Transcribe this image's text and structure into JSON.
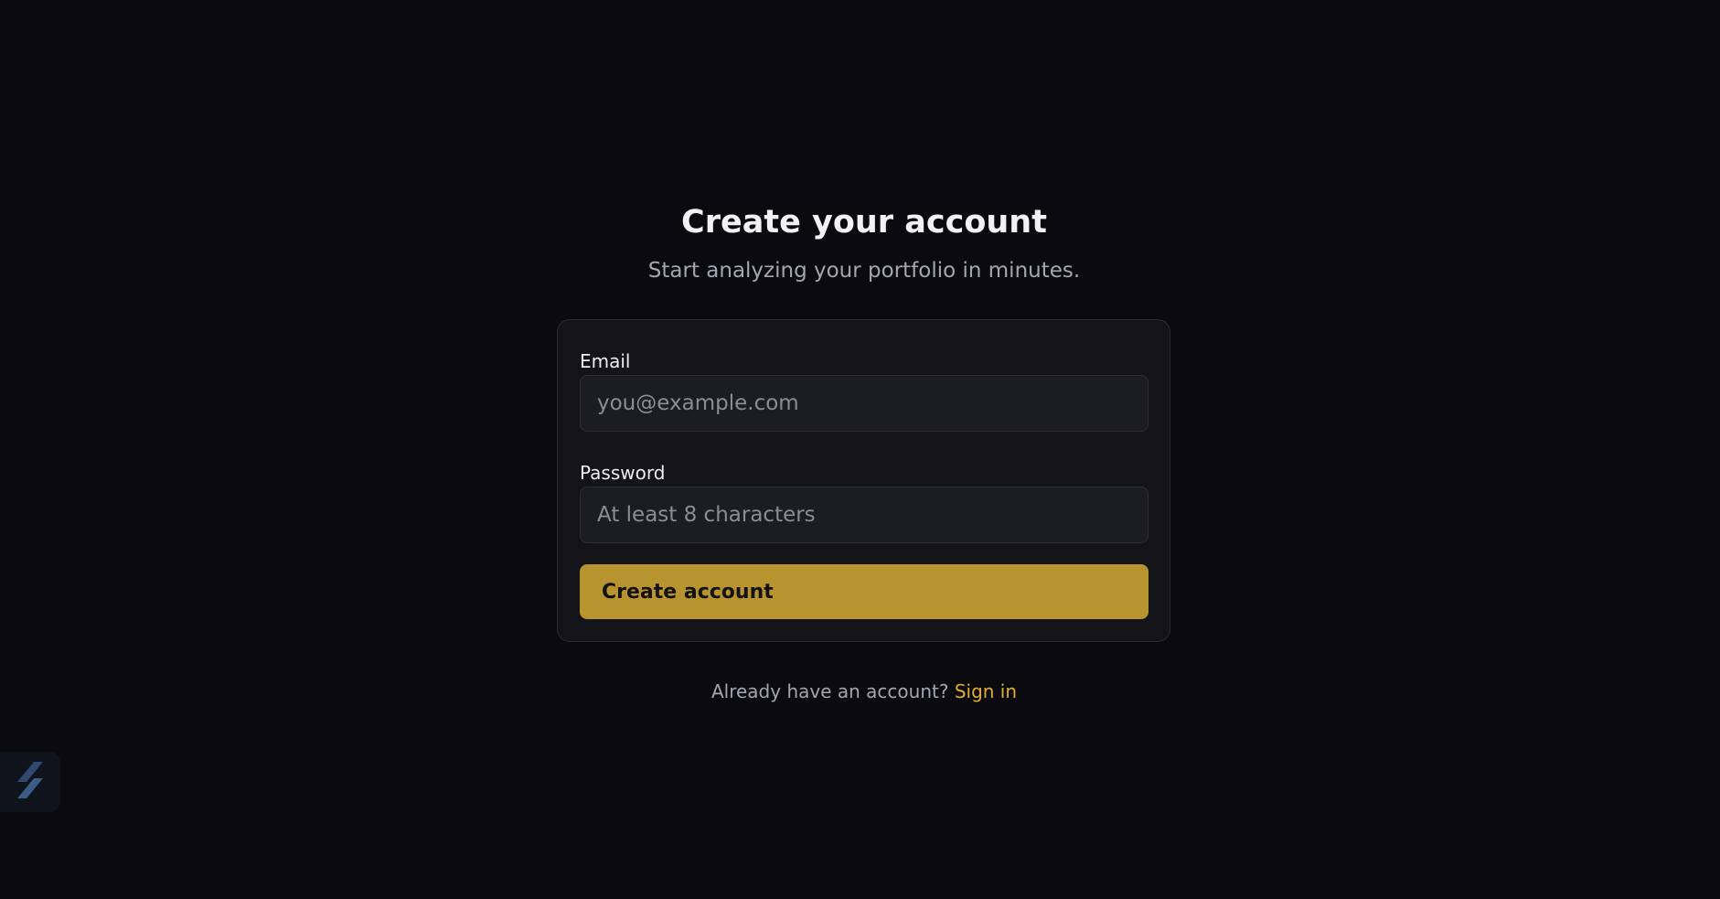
{
  "header": {
    "title": "Create your account",
    "subtitle": "Start analyzing your portfolio in minutes."
  },
  "form": {
    "email": {
      "label": "Email",
      "placeholder": "you@example.com",
      "value": ""
    },
    "password": {
      "label": "Password",
      "placeholder": "At least 8 characters",
      "value": ""
    },
    "submit_label": "Create account"
  },
  "footer": {
    "prompt": "Already have an account?",
    "link": "Sign in"
  },
  "widget": {
    "icon": "lightning-bolt-icon"
  },
  "colors": {
    "background": "#0b0b0f",
    "card": "#131318",
    "accent": "#b89431",
    "link": "#e0ae2e"
  }
}
